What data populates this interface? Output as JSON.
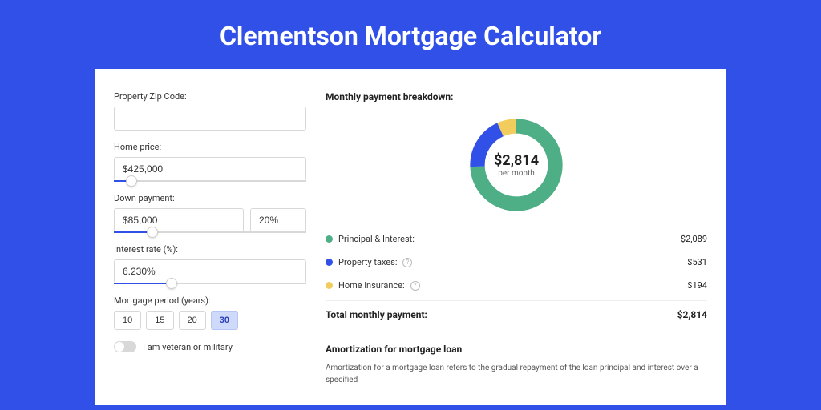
{
  "title": "Clementson Mortgage Calculator",
  "form": {
    "zip_label": "Property Zip Code:",
    "zip_value": "",
    "home_price_label": "Home price:",
    "home_price_value": "$425,000",
    "home_price_slider_pct": 9,
    "down_label": "Down payment:",
    "down_value": "$85,000",
    "down_pct_value": "20%",
    "down_slider_pct": 20,
    "rate_label": "Interest rate (%):",
    "rate_value": "6.230%",
    "rate_slider_pct": 30,
    "period_label": "Mortgage period (years):",
    "periods": [
      "10",
      "15",
      "20",
      "30"
    ],
    "period_active": "30",
    "veteran_label": "I am veteran or military",
    "veteran_on": false
  },
  "breakdown": {
    "title": "Monthly payment breakdown:",
    "total_amount": "$2,814",
    "total_sub": "per month",
    "items": [
      {
        "label": "Principal & Interest:",
        "value": "$2,089",
        "color": "#4eae86",
        "info": false,
        "num": 2089
      },
      {
        "label": "Property taxes:",
        "value": "$531",
        "color": "#3050e8",
        "info": true,
        "num": 531
      },
      {
        "label": "Home insurance:",
        "value": "$194",
        "color": "#f2cd5d",
        "info": true,
        "num": 194
      }
    ],
    "total_label": "Total monthly payment:",
    "total_value": "$2,814"
  },
  "amort": {
    "title": "Amortization for mortgage loan",
    "text": "Amortization for a mortgage loan refers to the gradual repayment of the loan principal and interest over a specified"
  },
  "chart_data": {
    "type": "pie",
    "title": "Monthly payment breakdown",
    "series": [
      {
        "name": "Principal & Interest",
        "value": 2089,
        "color": "#4eae86"
      },
      {
        "name": "Property taxes",
        "value": 531,
        "color": "#3050e8"
      },
      {
        "name": "Home insurance",
        "value": 194,
        "color": "#f2cd5d"
      }
    ],
    "total": 2814,
    "center_label": "$2,814",
    "center_sub": "per month"
  }
}
